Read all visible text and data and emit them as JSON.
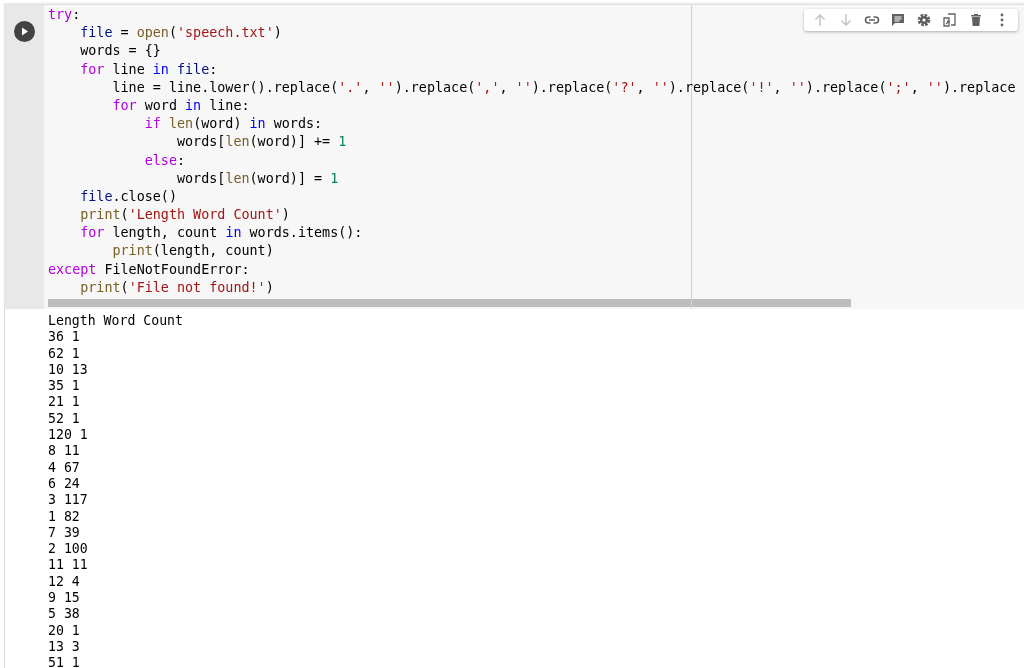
{
  "cell": {
    "toolbar": [
      {
        "kind": "up",
        "disabled": true
      },
      {
        "kind": "down",
        "disabled": true
      },
      {
        "kind": "link",
        "disabled": false
      },
      {
        "kind": "comment",
        "disabled": false
      },
      {
        "kind": "settings",
        "disabled": false
      },
      {
        "kind": "mirror",
        "disabled": false
      },
      {
        "kind": "delete",
        "disabled": false
      },
      {
        "kind": "more",
        "disabled": false
      }
    ],
    "code": [
      [
        {
          "kind": "kw",
          "text": "try"
        },
        {
          "kind": "p",
          "text": ":"
        }
      ],
      [
        {
          "kind": "var",
          "text": "    file"
        },
        {
          "kind": "p",
          "text": " = "
        },
        {
          "kind": "fn",
          "text": "open"
        },
        {
          "kind": "p",
          "text": "("
        },
        {
          "kind": "str",
          "text": "'speech.txt'"
        },
        {
          "kind": "p",
          "text": ")"
        }
      ],
      [
        {
          "kind": "p",
          "text": "    words = {}"
        }
      ],
      [
        {
          "kind": "kw",
          "text": "    for"
        },
        {
          "kind": "p",
          "text": " line "
        },
        {
          "kind": "in",
          "text": "in"
        },
        {
          "kind": "var",
          "text": " file"
        },
        {
          "kind": "p",
          "text": ":"
        }
      ],
      [
        {
          "kind": "p",
          "text": "        line = line.lower().replace("
        },
        {
          "kind": "str",
          "text": "'.'"
        },
        {
          "kind": "p",
          "text": ", "
        },
        {
          "kind": "str",
          "text": "''"
        },
        {
          "kind": "p",
          "text": ").replace("
        },
        {
          "kind": "str",
          "text": "','"
        },
        {
          "kind": "p",
          "text": ", "
        },
        {
          "kind": "str",
          "text": "''"
        },
        {
          "kind": "p",
          "text": ").replace("
        },
        {
          "kind": "str",
          "text": "'?'"
        },
        {
          "kind": "p",
          "text": ", "
        },
        {
          "kind": "str",
          "text": "''"
        },
        {
          "kind": "p",
          "text": ").replace("
        },
        {
          "kind": "str",
          "text": "'!'"
        },
        {
          "kind": "p",
          "text": ", "
        },
        {
          "kind": "str",
          "text": "''"
        },
        {
          "kind": "p",
          "text": ").replace("
        },
        {
          "kind": "str",
          "text": "';'"
        },
        {
          "kind": "p",
          "text": ", "
        },
        {
          "kind": "str",
          "text": "''"
        },
        {
          "kind": "p",
          "text": ").replace"
        }
      ],
      [
        {
          "kind": "kw",
          "text": "        for"
        },
        {
          "kind": "p",
          "text": " word "
        },
        {
          "kind": "in",
          "text": "in"
        },
        {
          "kind": "p",
          "text": " line:"
        }
      ],
      [
        {
          "kind": "kw",
          "text": "            if"
        },
        {
          "kind": "fn",
          "text": " len"
        },
        {
          "kind": "p",
          "text": "(word) "
        },
        {
          "kind": "in",
          "text": "in"
        },
        {
          "kind": "p",
          "text": " words:"
        }
      ],
      [
        {
          "kind": "p",
          "text": "                words["
        },
        {
          "kind": "fn",
          "text": "len"
        },
        {
          "kind": "p",
          "text": "(word)] += "
        },
        {
          "kind": "num",
          "text": "1"
        }
      ],
      [
        {
          "kind": "kw",
          "text": "            else"
        },
        {
          "kind": "p",
          "text": ":"
        }
      ],
      [
        {
          "kind": "p",
          "text": "                words["
        },
        {
          "kind": "fn",
          "text": "len"
        },
        {
          "kind": "p",
          "text": "(word)] = "
        },
        {
          "kind": "num",
          "text": "1"
        }
      ],
      [
        {
          "kind": "var",
          "text": "    file"
        },
        {
          "kind": "p",
          "text": ".close()"
        }
      ],
      [
        {
          "kind": "fn",
          "text": "    print"
        },
        {
          "kind": "p",
          "text": "("
        },
        {
          "kind": "str",
          "text": "'Length Word Count'"
        },
        {
          "kind": "p",
          "text": ")"
        }
      ],
      [
        {
          "kind": "kw",
          "text": "    for"
        },
        {
          "kind": "p",
          "text": " length, count "
        },
        {
          "kind": "in",
          "text": "in"
        },
        {
          "kind": "p",
          "text": " words.items():"
        }
      ],
      [
        {
          "kind": "fn",
          "text": "        print"
        },
        {
          "kind": "p",
          "text": "(length, count)"
        }
      ],
      [
        {
          "kind": "kw",
          "text": "except"
        },
        {
          "kind": "p",
          "text": " FileNotFoundError:"
        }
      ],
      [
        {
          "kind": "fn",
          "text": "    print"
        },
        {
          "kind": "p",
          "text": "("
        },
        {
          "kind": "str",
          "text": "'File not found!'"
        },
        {
          "kind": "p",
          "text": ")"
        }
      ]
    ],
    "output": [
      "Length Word Count",
      "36 1",
      "62 1",
      "10 13",
      "35 1",
      "21 1",
      "52 1",
      "120 1",
      "8 11",
      "4 67",
      "6 24",
      "3 117",
      "1 82",
      "7 39",
      "2 100",
      "11 11",
      "12 4",
      "9 15",
      "5 38",
      "20 1",
      "13 3",
      "51 1"
    ]
  }
}
